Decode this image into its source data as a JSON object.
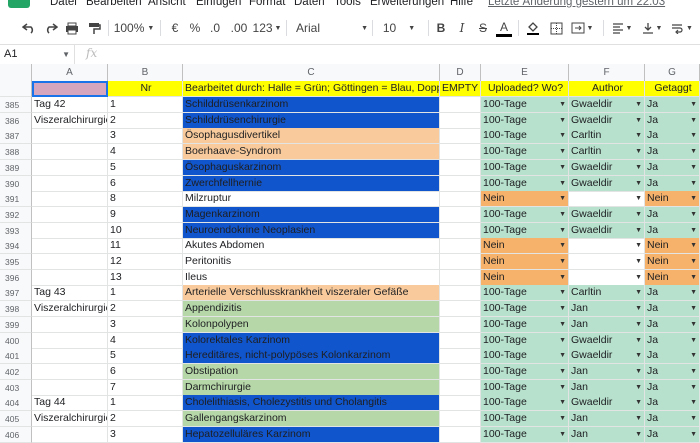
{
  "menubar": {
    "items": [
      "Datei",
      "Bearbeiten",
      "Ansicht",
      "Einfügen",
      "Format",
      "Daten",
      "Tools",
      "Erweiterungen",
      "Hilfe"
    ],
    "last_edit": "Letzte Änderung gestern um 22:03"
  },
  "toolbar": {
    "zoom": "100%",
    "currency": "€",
    "percent": "%",
    "decrease_decimals": ".0",
    "increase_decimals": ".00",
    "more_formats": "123",
    "font": "Arial",
    "font_size": "10",
    "bold": "B",
    "italic": "I",
    "strike": "S",
    "text_color": "A"
  },
  "formula_bar": {
    "cell_ref": "A1",
    "fx": "fx",
    "value": ""
  },
  "columns": [
    "A",
    "B",
    "C",
    "D",
    "E",
    "F",
    "G"
  ],
  "header_row": {
    "a": "",
    "b": "Nr",
    "c": "Bearbeitet durch: Halle = Grün; Göttingen = Blau, Doppel",
    "d": "EMPTY",
    "e": "Uploaded? Wo?",
    "f": "Author",
    "g": "Getaggt"
  },
  "rows": [
    {
      "n": "385",
      "a": "Tag 42",
      "b": "1",
      "c": "Schilddrüsenkarzinom",
      "cc": "blue",
      "e": "100-Tage",
      "ec": "mint",
      "f": "Gwaeldir",
      "fc": "mint",
      "g": "Ja",
      "gc": "mint"
    },
    {
      "n": "386",
      "a": "Viszeralchirurgie",
      "b": "2",
      "c": "Schilddrüsenchirurgie",
      "cc": "blue",
      "e": "100-Tage",
      "ec": "mint",
      "f": "Gwaeldir",
      "fc": "mint",
      "g": "Ja",
      "gc": "mint"
    },
    {
      "n": "387",
      "a": "",
      "b": "3",
      "c": "Ösophagusdivertikel",
      "cc": "orange",
      "e": "100-Tage",
      "ec": "mint",
      "f": "Carltin",
      "fc": "mint",
      "g": "Ja",
      "gc": "mint"
    },
    {
      "n": "388",
      "a": "",
      "b": "4",
      "c": "Boerhaave-Syndrom",
      "cc": "orange",
      "e": "100-Tage",
      "ec": "mint",
      "f": "Carltin",
      "fc": "mint",
      "g": "Ja",
      "gc": "mint"
    },
    {
      "n": "389",
      "a": "",
      "b": "5",
      "c": "Ösophaguskarzinom",
      "cc": "blue",
      "e": "100-Tage",
      "ec": "mint",
      "f": "Gwaeldir",
      "fc": "mint",
      "g": "Ja",
      "gc": "mint"
    },
    {
      "n": "390",
      "a": "",
      "b": "6",
      "c": "Zwerchfellhernie",
      "cc": "blue",
      "e": "100-Tage",
      "ec": "mint",
      "f": "Gwaeldir",
      "fc": "mint",
      "g": "Ja",
      "gc": "mint"
    },
    {
      "n": "391",
      "a": "",
      "b": "8",
      "c": "Milzruptur",
      "cc": "none",
      "e": "Nein",
      "ec": "amber",
      "f": "",
      "fc": "none",
      "g": "Nein",
      "gc": "amber"
    },
    {
      "n": "392",
      "a": "",
      "b": "9",
      "c": "Magenkarzinom",
      "cc": "blue",
      "e": "100-Tage",
      "ec": "mint",
      "f": "Gwaeldir",
      "fc": "mint",
      "g": "Ja",
      "gc": "mint"
    },
    {
      "n": "393",
      "a": "",
      "b": "10",
      "c": "Neuroendokrine Neoplasien",
      "cc": "blue",
      "e": "100-Tage",
      "ec": "mint",
      "f": "Gwaeldir",
      "fc": "mint",
      "g": "Ja",
      "gc": "mint"
    },
    {
      "n": "394",
      "a": "",
      "b": "11",
      "c": "Akutes Abdomen",
      "cc": "none",
      "e": "Nein",
      "ec": "amber",
      "f": "",
      "fc": "none",
      "g": "Nein",
      "gc": "amber"
    },
    {
      "n": "395",
      "a": "",
      "b": "12",
      "c": "Peritonitis",
      "cc": "none",
      "e": "Nein",
      "ec": "amber",
      "f": "",
      "fc": "none",
      "g": "Nein",
      "gc": "amber"
    },
    {
      "n": "396",
      "a": "",
      "b": "13",
      "c": "Ileus",
      "cc": "none",
      "e": "Nein",
      "ec": "amber",
      "f": "",
      "fc": "none",
      "g": "Nein",
      "gc": "amber"
    },
    {
      "n": "397",
      "a": "Tag 43",
      "b": "1",
      "c": "Arterielle Verschlusskrankheit viszeraler Gefäße",
      "cc": "orange",
      "e": "100-Tage",
      "ec": "mint",
      "f": "Carltin",
      "fc": "mint",
      "g": "Ja",
      "gc": "mint"
    },
    {
      "n": "398",
      "a": "Viszeralchirurgie",
      "b": "2",
      "c": "Appendizitis",
      "cc": "green",
      "e": "100-Tage",
      "ec": "mint",
      "f": "Jan",
      "fc": "mint",
      "g": "Ja",
      "gc": "mint"
    },
    {
      "n": "399",
      "a": "",
      "b": "3",
      "c": "Kolonpolypen",
      "cc": "green",
      "e": "100-Tage",
      "ec": "mint",
      "f": "Jan",
      "fc": "mint",
      "g": "Ja",
      "gc": "mint"
    },
    {
      "n": "400",
      "a": "",
      "b": "4",
      "c": "Kolorektales Karzinom",
      "cc": "blue",
      "e": "100-Tage",
      "ec": "mint",
      "f": "Gwaeldir",
      "fc": "mint",
      "g": "Ja",
      "gc": "mint"
    },
    {
      "n": "401",
      "a": "",
      "b": "5",
      "c": "Hereditäres, nicht-polypöses Kolonkarzinom",
      "cc": "blue",
      "e": "100-Tage",
      "ec": "mint",
      "f": "Gwaeldir",
      "fc": "mint",
      "g": "Ja",
      "gc": "mint"
    },
    {
      "n": "402",
      "a": "",
      "b": "6",
      "c": "Obstipation",
      "cc": "green",
      "e": "100-Tage",
      "ec": "mint",
      "f": "Jan",
      "fc": "mint",
      "g": "Ja",
      "gc": "mint"
    },
    {
      "n": "403",
      "a": "",
      "b": "7",
      "c": "Darmchirurgie",
      "cc": "green",
      "e": "100-Tage",
      "ec": "mint",
      "f": "Jan",
      "fc": "mint",
      "g": "Ja",
      "gc": "mint"
    },
    {
      "n": "404",
      "a": "Tag 44",
      "b": "1",
      "c": "Cholelithiasis, Cholezystitis und Cholangitis",
      "cc": "blue",
      "e": "100-Tage",
      "ec": "mint",
      "f": "Gwaeldir",
      "fc": "mint",
      "g": "Ja",
      "gc": "mint"
    },
    {
      "n": "405",
      "a": "Viszeralchirurgie",
      "b": "2",
      "c": "Gallengangskarzinom",
      "cc": "green",
      "e": "100-Tage",
      "ec": "mint",
      "f": "Jan",
      "fc": "mint",
      "g": "Ja",
      "gc": "mint"
    },
    {
      "n": "406",
      "a": "",
      "b": "3",
      "c": "Hepatozelluläres Karzinom",
      "cc": "blue",
      "e": "100-Tage",
      "ec": "mint",
      "f": "Jan",
      "fc": "mint",
      "g": "Ja",
      "gc": "mint"
    }
  ],
  "colors": {
    "blue": "#1155cc",
    "orange": "#f9cb9c",
    "green": "#b6d7a8",
    "mint": "#b7e1cd",
    "amber": "#f6b26b",
    "header_yellow": "#ffff00"
  }
}
